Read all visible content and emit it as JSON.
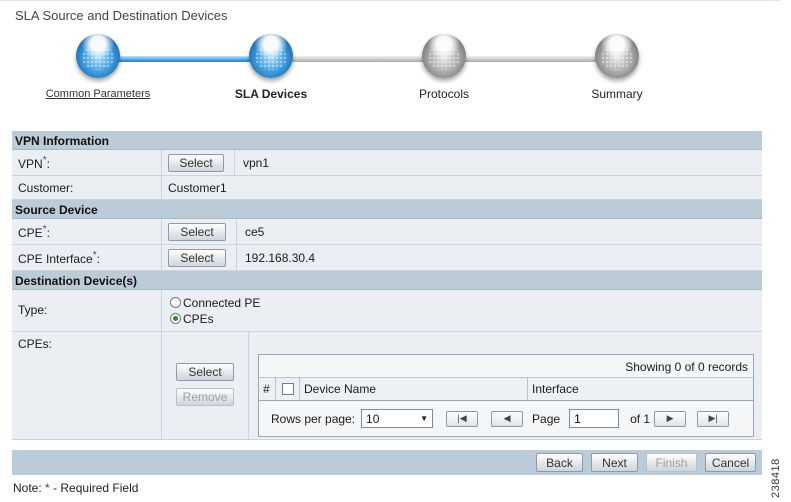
{
  "page": {
    "title": "SLA Source and Destination Devices"
  },
  "wizard": {
    "steps": [
      {
        "label": "Common Parameters",
        "state": "completed"
      },
      {
        "label": "SLA Devices",
        "state": "current"
      },
      {
        "label": "Protocols",
        "state": "pending"
      },
      {
        "label": "Summary",
        "state": "pending"
      }
    ],
    "colors": {
      "active": "#3d9be0",
      "inactive": "#a9a9a9"
    }
  },
  "vpn_section": {
    "title": "VPN Information",
    "vpn": {
      "label": "VPN",
      "required_mark": "*",
      "button": "Select",
      "value": "vpn1"
    },
    "customer": {
      "label": "Customer:",
      "value": "Customer1"
    }
  },
  "source_section": {
    "title": "Source Device",
    "cpe": {
      "label": "CPE",
      "required_mark": "*",
      "button": "Select",
      "value": "ce5"
    },
    "cpe_interface": {
      "label": "CPE Interface",
      "required_mark": "*",
      "button": "Select",
      "value": "192.168.30.4"
    }
  },
  "destination_section": {
    "title": "Destination Device(s)",
    "type": {
      "label": "Type:",
      "options": [
        {
          "label": "Connected PE",
          "selected": false
        },
        {
          "label": "CPEs",
          "selected": true
        }
      ]
    },
    "cpes": {
      "label": "CPEs:",
      "select_button": "Select",
      "remove_button": "Remove",
      "table": {
        "record_summary": "Showing 0 of 0 records",
        "columns": [
          "#",
          "Device Name",
          "Interface"
        ],
        "rows_per_page_label": "Rows per page:",
        "rows_per_page_value": "10",
        "page_label": "Page",
        "page_value": "1",
        "of_label": "of 1"
      }
    }
  },
  "footer": {
    "buttons": {
      "back": "Back",
      "next": "Next",
      "finish": "Finish",
      "cancel": "Cancel"
    }
  },
  "note": {
    "prefix": "Note:",
    "star": "*",
    "text": "- Required Field"
  },
  "figure_id": "238418"
}
